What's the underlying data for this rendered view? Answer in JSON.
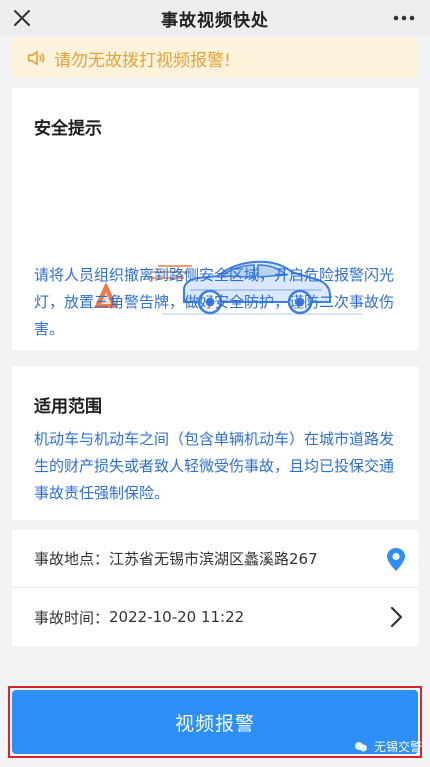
{
  "header": {
    "title": "事故视频快处"
  },
  "notice": {
    "text": "请勿无故拨打视频报警!"
  },
  "safety": {
    "title": "安全提示",
    "text": "请将人员组织撤离到路侧安全区域，开启危险报警闪光灯，放置三角警告牌，做好安全防护，谨防二次事故伤害。"
  },
  "scope": {
    "title": "适用范围",
    "text": "机动车与机动车之间（包含单辆机动车）在城市道路发生的财产损失或者致人轻微受伤事故，且均已投保交通事故责任强制保险。"
  },
  "info": {
    "location_label": "事故地点：",
    "location_value": "江苏省无锡市滨湖区蠡溪路267",
    "time_label": "事故时间：",
    "time_value": "2022-10-20 11:22"
  },
  "cta": {
    "label": "视频报警"
  },
  "watermark": {
    "text": "无锡交警"
  },
  "colors": {
    "accent": "#2b8ff5",
    "notice_bg": "#fdf3dc",
    "notice_text": "#e2a438",
    "body_text_blue": "#2d6fd4",
    "highlight_red": "#d9232d"
  },
  "icons": {
    "close": "close-icon",
    "more": "more-icon",
    "speaker": "speaker-icon",
    "location": "location-pin-icon",
    "chevron": "chevron-right-icon"
  }
}
